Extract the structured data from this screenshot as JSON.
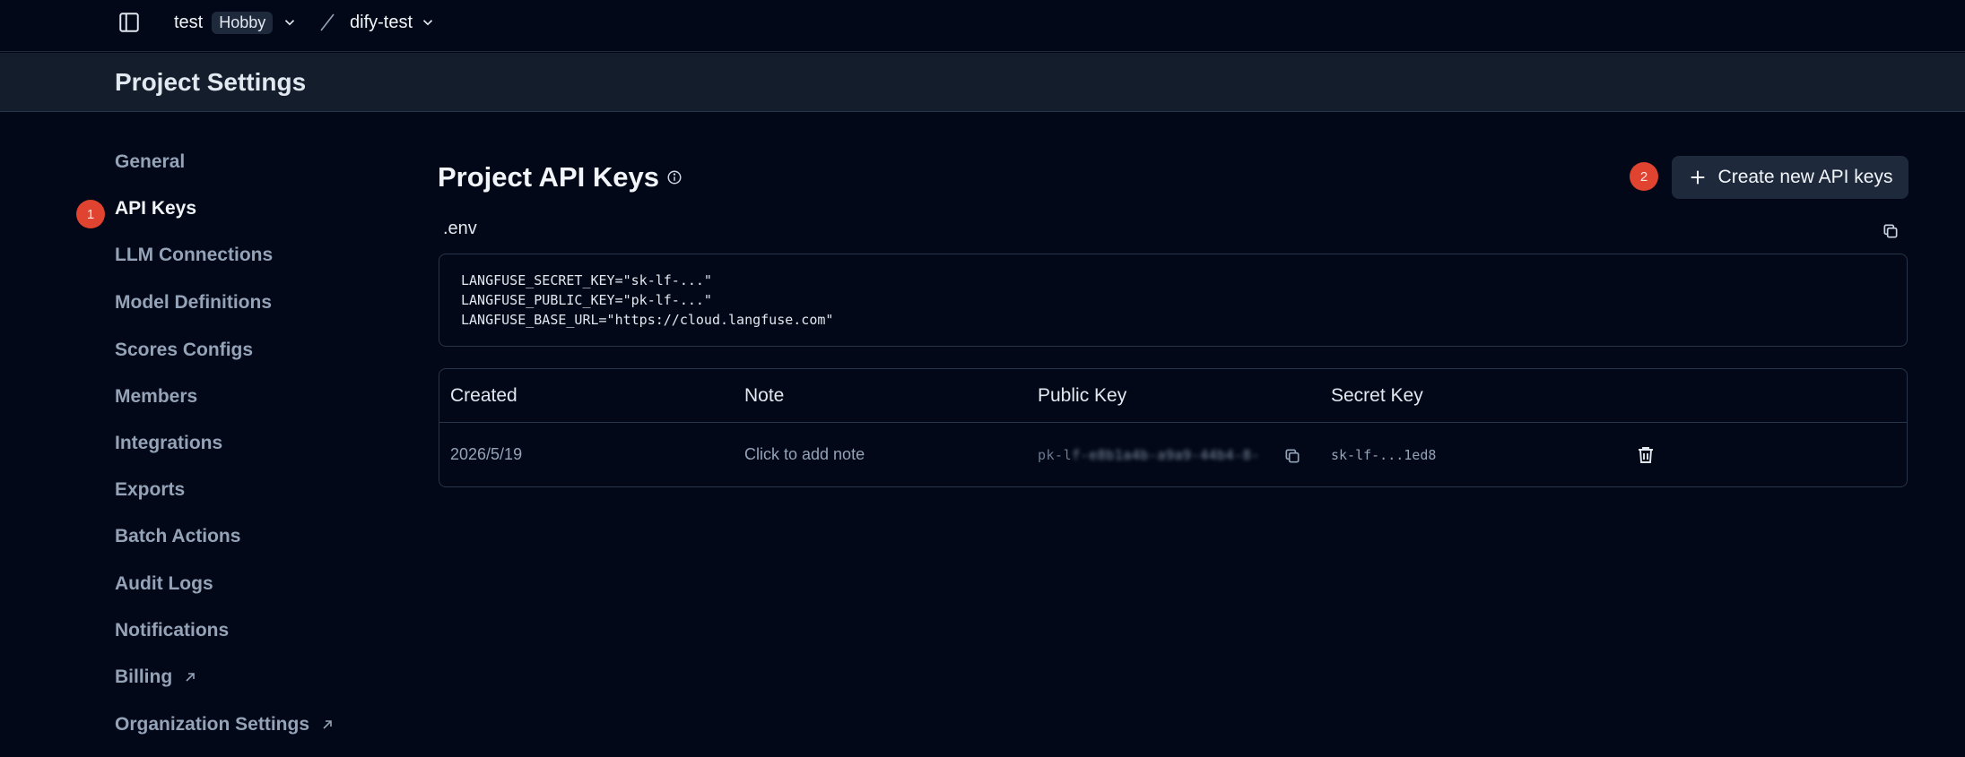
{
  "topbar": {
    "org_name": "test",
    "plan_badge": "Hobby",
    "project_name": "dify-test"
  },
  "page": {
    "title": "Project Settings"
  },
  "nav": {
    "items": [
      {
        "label": "General",
        "external": false
      },
      {
        "label": "API Keys",
        "external": false,
        "active": true
      },
      {
        "label": "LLM Connections",
        "external": false
      },
      {
        "label": "Model Definitions",
        "external": false
      },
      {
        "label": "Scores Configs",
        "external": false
      },
      {
        "label": "Members",
        "external": false
      },
      {
        "label": "Integrations",
        "external": false
      },
      {
        "label": "Exports",
        "external": false
      },
      {
        "label": "Batch Actions",
        "external": false
      },
      {
        "label": "Audit Logs",
        "external": false
      },
      {
        "label": "Notifications",
        "external": false
      },
      {
        "label": "Billing",
        "external": true
      },
      {
        "label": "Organization Settings",
        "external": true
      }
    ]
  },
  "markers": {
    "step1": "1",
    "step2": "2"
  },
  "main": {
    "section_title": "Project API Keys",
    "create_button_label": "Create new API keys",
    "env_label": ".env",
    "env_lines": [
      "LANGFUSE_SECRET_KEY=\"sk-lf-...\"",
      "LANGFUSE_PUBLIC_KEY=\"pk-lf-...\"",
      "LANGFUSE_BASE_URL=\"https://cloud.langfuse.com\""
    ],
    "table": {
      "headers": [
        "Created",
        "Note",
        "Public Key",
        "Secret Key"
      ],
      "rows": [
        {
          "created": "2026/5/19",
          "note": "Click to add note",
          "public_key_prefix": "pk-l",
          "public_key_masked": "f-e8b1a4b-a9a9-44b4-8-",
          "secret_key": "sk-lf-...1ed8"
        }
      ]
    }
  },
  "colors": {
    "background": "#020817",
    "header_band": "#141d2b",
    "border": "#283548",
    "marker": "#e0432f",
    "button_bg": "#1e293b"
  }
}
